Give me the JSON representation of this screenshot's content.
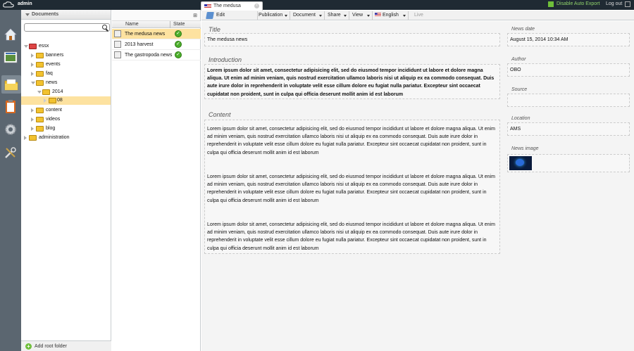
{
  "topbar": {
    "user": "admin",
    "export_label": "Disable Auto Export",
    "logout_label": "Log out"
  },
  "doc_tab": {
    "title": "The medusa"
  },
  "rail": {
    "items": [
      "home-icon",
      "pages-icon",
      "documents-icon",
      "reports-icon",
      "settings-icon",
      "tools-icon"
    ]
  },
  "tree": {
    "header": "Documents",
    "search_placeholder": "",
    "nodes": [
      {
        "label": "essx",
        "depth": 0
      },
      {
        "label": "banners",
        "depth": 1
      },
      {
        "label": "events",
        "depth": 1
      },
      {
        "label": "faq",
        "depth": 1
      },
      {
        "label": "news",
        "depth": 1
      },
      {
        "label": "2014",
        "depth": 2
      },
      {
        "label": "08",
        "depth": 3
      },
      {
        "label": "content",
        "depth": 1
      },
      {
        "label": "videos",
        "depth": 1
      },
      {
        "label": "blog",
        "depth": 1
      },
      {
        "label": "administration",
        "depth": 0
      }
    ],
    "add_root": "Add root folder"
  },
  "list": {
    "col_button": "⊞",
    "columns": {
      "name": "Name",
      "state": "State"
    },
    "rows": [
      {
        "name": "The medusa news",
        "state": "published"
      },
      {
        "name": "2013 harvest",
        "state": "published"
      },
      {
        "name": "The gastropoda news",
        "state": "published"
      }
    ]
  },
  "toolbar": {
    "edit": "Edit",
    "publication": "Publication",
    "document": "Document",
    "share": "Share",
    "view": "View",
    "language": "English",
    "live": "Live"
  },
  "editor": {
    "title_label": "Title",
    "title_value": "The medusa news",
    "intro_label": "Introduction",
    "intro_text": "Lorem ipsum dolor sit amet, consectetur adipisicing elit, sed do eiusmod tempor incididunt ut labore et dolore magna aliqua. Ut enim ad minim veniam, quis nostrud exercitation ullamco laboris nisi ut aliquip ex ea commodo consequat. Duis aute irure dolor in reprehenderit in voluptate velit esse cillum dolore eu fugiat nulla pariatur. Excepteur sint occaecat cupidatat non proident, sunt in culpa qui officia deserunt mollit anim id est laborum",
    "content_label": "Content",
    "content_paragraphs": [
      "Lorem ipsum dolor sit amet, consectetur adipisicing elit, sed do eiusmod tempor incididunt ut labore et dolore magna aliqua. Ut enim ad minim veniam, quis nostrud exercitation ullamco laboris nisi ut aliquip ex ea commodo consequat. Duis aute irure dolor in reprehenderit in voluptate velit esse cillum dolore eu fugiat nulla pariatur. Excepteur sint occaecat cupidatat non proident, sunt in culpa qui officia deserunt mollit anim id est laborum",
      "Lorem ipsum dolor sit amet, consectetur adipisicing elit, sed do eiusmod tempor incididunt ut labore et dolore magna aliqua. Ut enim ad minim veniam, quis nostrud exercitation ullamco laboris nisi ut aliquip ex ea commodo consequat. Duis aute irure dolor in reprehenderit in voluptate velit esse cillum dolore eu fugiat nulla pariatur. Excepteur sint occaecat cupidatat non proident, sunt in culpa qui officia deserunt mollit anim id est laborum",
      "Lorem ipsum dolor sit amet, consectetur adipisicing elit, sed do eiusmod tempor incididunt ut labore et dolore magna aliqua. Ut enim ad minim veniam, quis nostrud exercitation ullamco laboris nisi ut aliquip ex ea commodo consequat. Duis aute irure dolor in reprehenderit in voluptate velit esse cillum dolore eu fugiat nulla pariatur. Excepteur sint occaecat cupidatat non proident, sunt in culpa qui officia deserunt mollit anim id est laborum"
    ],
    "news_date_label": "News date",
    "news_date_value": "August 15, 2014 10:34 AM",
    "author_label": "Author",
    "author_value": "OBO",
    "source_label": "Source",
    "source_value": "",
    "location_label": "Location",
    "location_value": "AMS",
    "image_label": "News image"
  },
  "colors": {
    "topbar": "#1f2a33",
    "rail": "#5b6670",
    "selection": "#fde2a0",
    "export_green": "#8fd16b",
    "published_green": "#4caf2a"
  }
}
